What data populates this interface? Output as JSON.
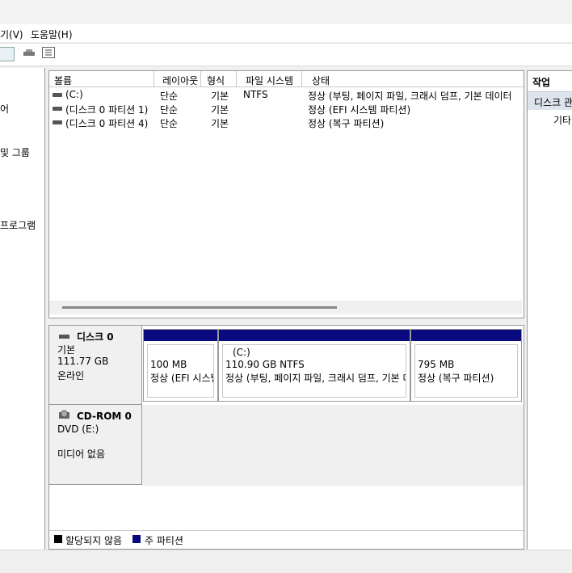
{
  "menu": {
    "view_label": "기(V)",
    "help_label": "도움말(H)"
  },
  "left_pane": {
    "items": [
      {
        "label": "어"
      },
      {
        "label": "및 그룹"
      },
      {
        "label": "프로그램"
      }
    ]
  },
  "volume_list": {
    "columns": [
      "볼륨",
      "레이아웃",
      "형식",
      "파일 시스템",
      "상태"
    ],
    "rows": [
      {
        "volume": "(C:)",
        "layout": "단순",
        "type": "기본",
        "fs": "NTFS",
        "status": "정상 (부팅, 페이지 파일, 크래시 덤프, 기본 데이터"
      },
      {
        "volume": "(디스크 0 파티션 1)",
        "layout": "단순",
        "type": "기본",
        "fs": "",
        "status": "정상 (EFI 시스템 파티션)"
      },
      {
        "volume": "(디스크 0 파티션 4)",
        "layout": "단순",
        "type": "기본",
        "fs": "",
        "status": "정상 (복구 파티션)"
      }
    ]
  },
  "disks": [
    {
      "name": "디스크 0",
      "kind": "기본",
      "size": "111.77 GB",
      "state": "온라인",
      "partitions": [
        {
          "title": "",
          "size": "100 MB",
          "status": "정상 (EFI 시스템 파티션)"
        },
        {
          "title": "(C:)",
          "size": "110.90 GB NTFS",
          "status": "정상 (부팅, 페이지 파일, 크래시 덤프, 기본 데이터 파티션)"
        },
        {
          "title": "",
          "size": "795 MB",
          "status": "정상 (복구 파티션)"
        }
      ]
    },
    {
      "name": "CD-ROM 0",
      "kind": "DVD (E:)",
      "state": "미디어 없음"
    }
  ],
  "legend": {
    "unallocated": "할당되지 않음",
    "primary": "주 파티션",
    "unallocated_color": "#000000",
    "primary_color": "#0a0a80"
  },
  "actions": {
    "header": "작업",
    "section": "디스크 관리",
    "item": "기타 작업"
  },
  "icons": [
    "toolbar-console-icon",
    "toolbar-disk-icon",
    "toolbar-properties-icon",
    "volume-icon",
    "disk-icon",
    "cdrom-icon"
  ]
}
